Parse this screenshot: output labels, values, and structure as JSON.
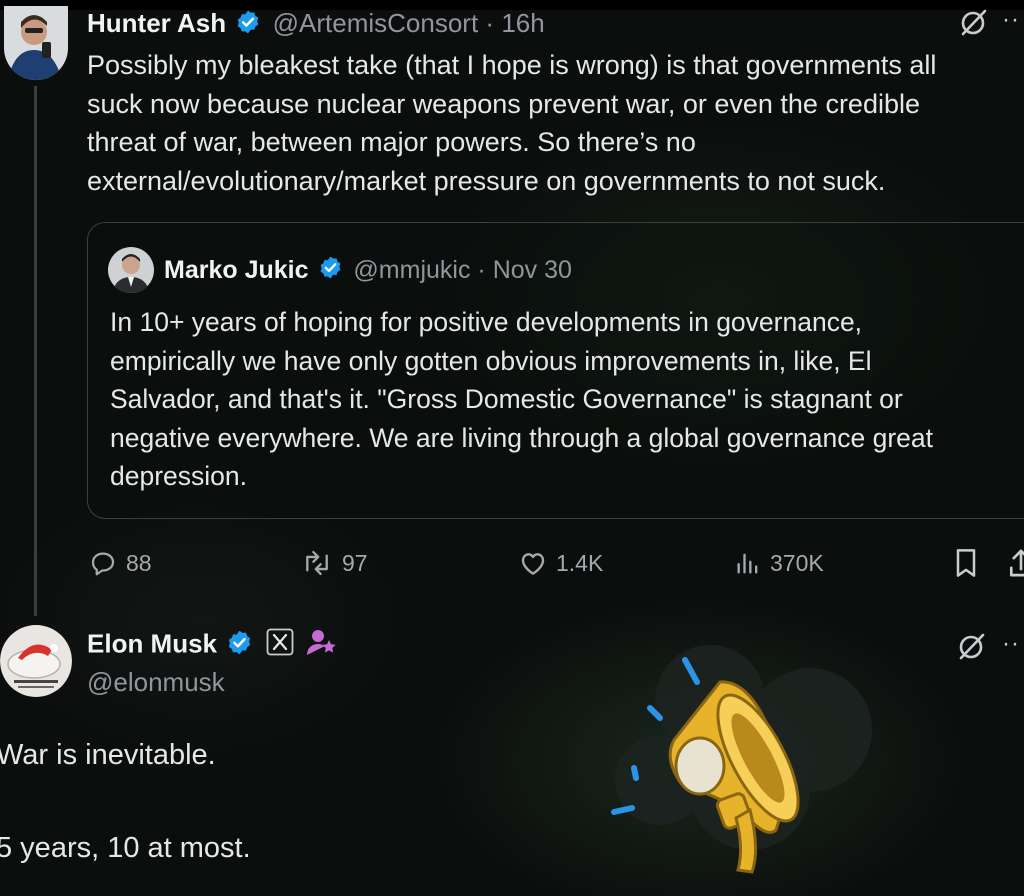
{
  "tweet": {
    "author_name": "Hunter Ash",
    "author_handle": "@ArtemisConsort",
    "separator": "·",
    "time": "16h",
    "text_lines": [
      "Possibly my bleakest take (that I hope is wrong) is that governments all",
      "suck now because nuclear weapons prevent war, or even the credible",
      "threat of war, between major powers. So there’s no",
      "external/evolutionary/market pressure on governments to not suck."
    ],
    "quote": {
      "author_name": "Marko Jukic",
      "author_handle": "@mmjukic",
      "separator": "·",
      "date": "Nov 30",
      "text_lines": [
        "In 10+ years of hoping for positive developments in governance,",
        "empirically we have only gotten obvious improvements in, like, El",
        "Salvador, and that's it. \"Gross Domestic Governance\" is stagnant or",
        "negative everywhere. We are living through a global governance great",
        "depression."
      ]
    },
    "actions": {
      "replies": "88",
      "reposts": "97",
      "likes": "1.4K",
      "views": "370K"
    }
  },
  "reply": {
    "author_name": "Elon Musk",
    "author_handle": "@elonmusk",
    "text_lines": [
      "War is inevitable.",
      "5 years, 10 at most."
    ]
  },
  "icons": {
    "verified": "verified-badge-icon",
    "grok": "grok-icon",
    "more": "more-icon",
    "reply": "reply-icon",
    "repost": "repost-icon",
    "like": "like-icon",
    "views": "views-icon",
    "bookmark": "bookmark-icon",
    "share": "share-icon",
    "x_affiliate": "x-logo-icon",
    "subscriber": "person-star-icon",
    "overlay": "megaphone-icon"
  },
  "colors": {
    "verified": "#1d9bf0",
    "subscriber": "#c66ad6",
    "megaphone": "#e6b32b"
  },
  "more_dots": "··"
}
